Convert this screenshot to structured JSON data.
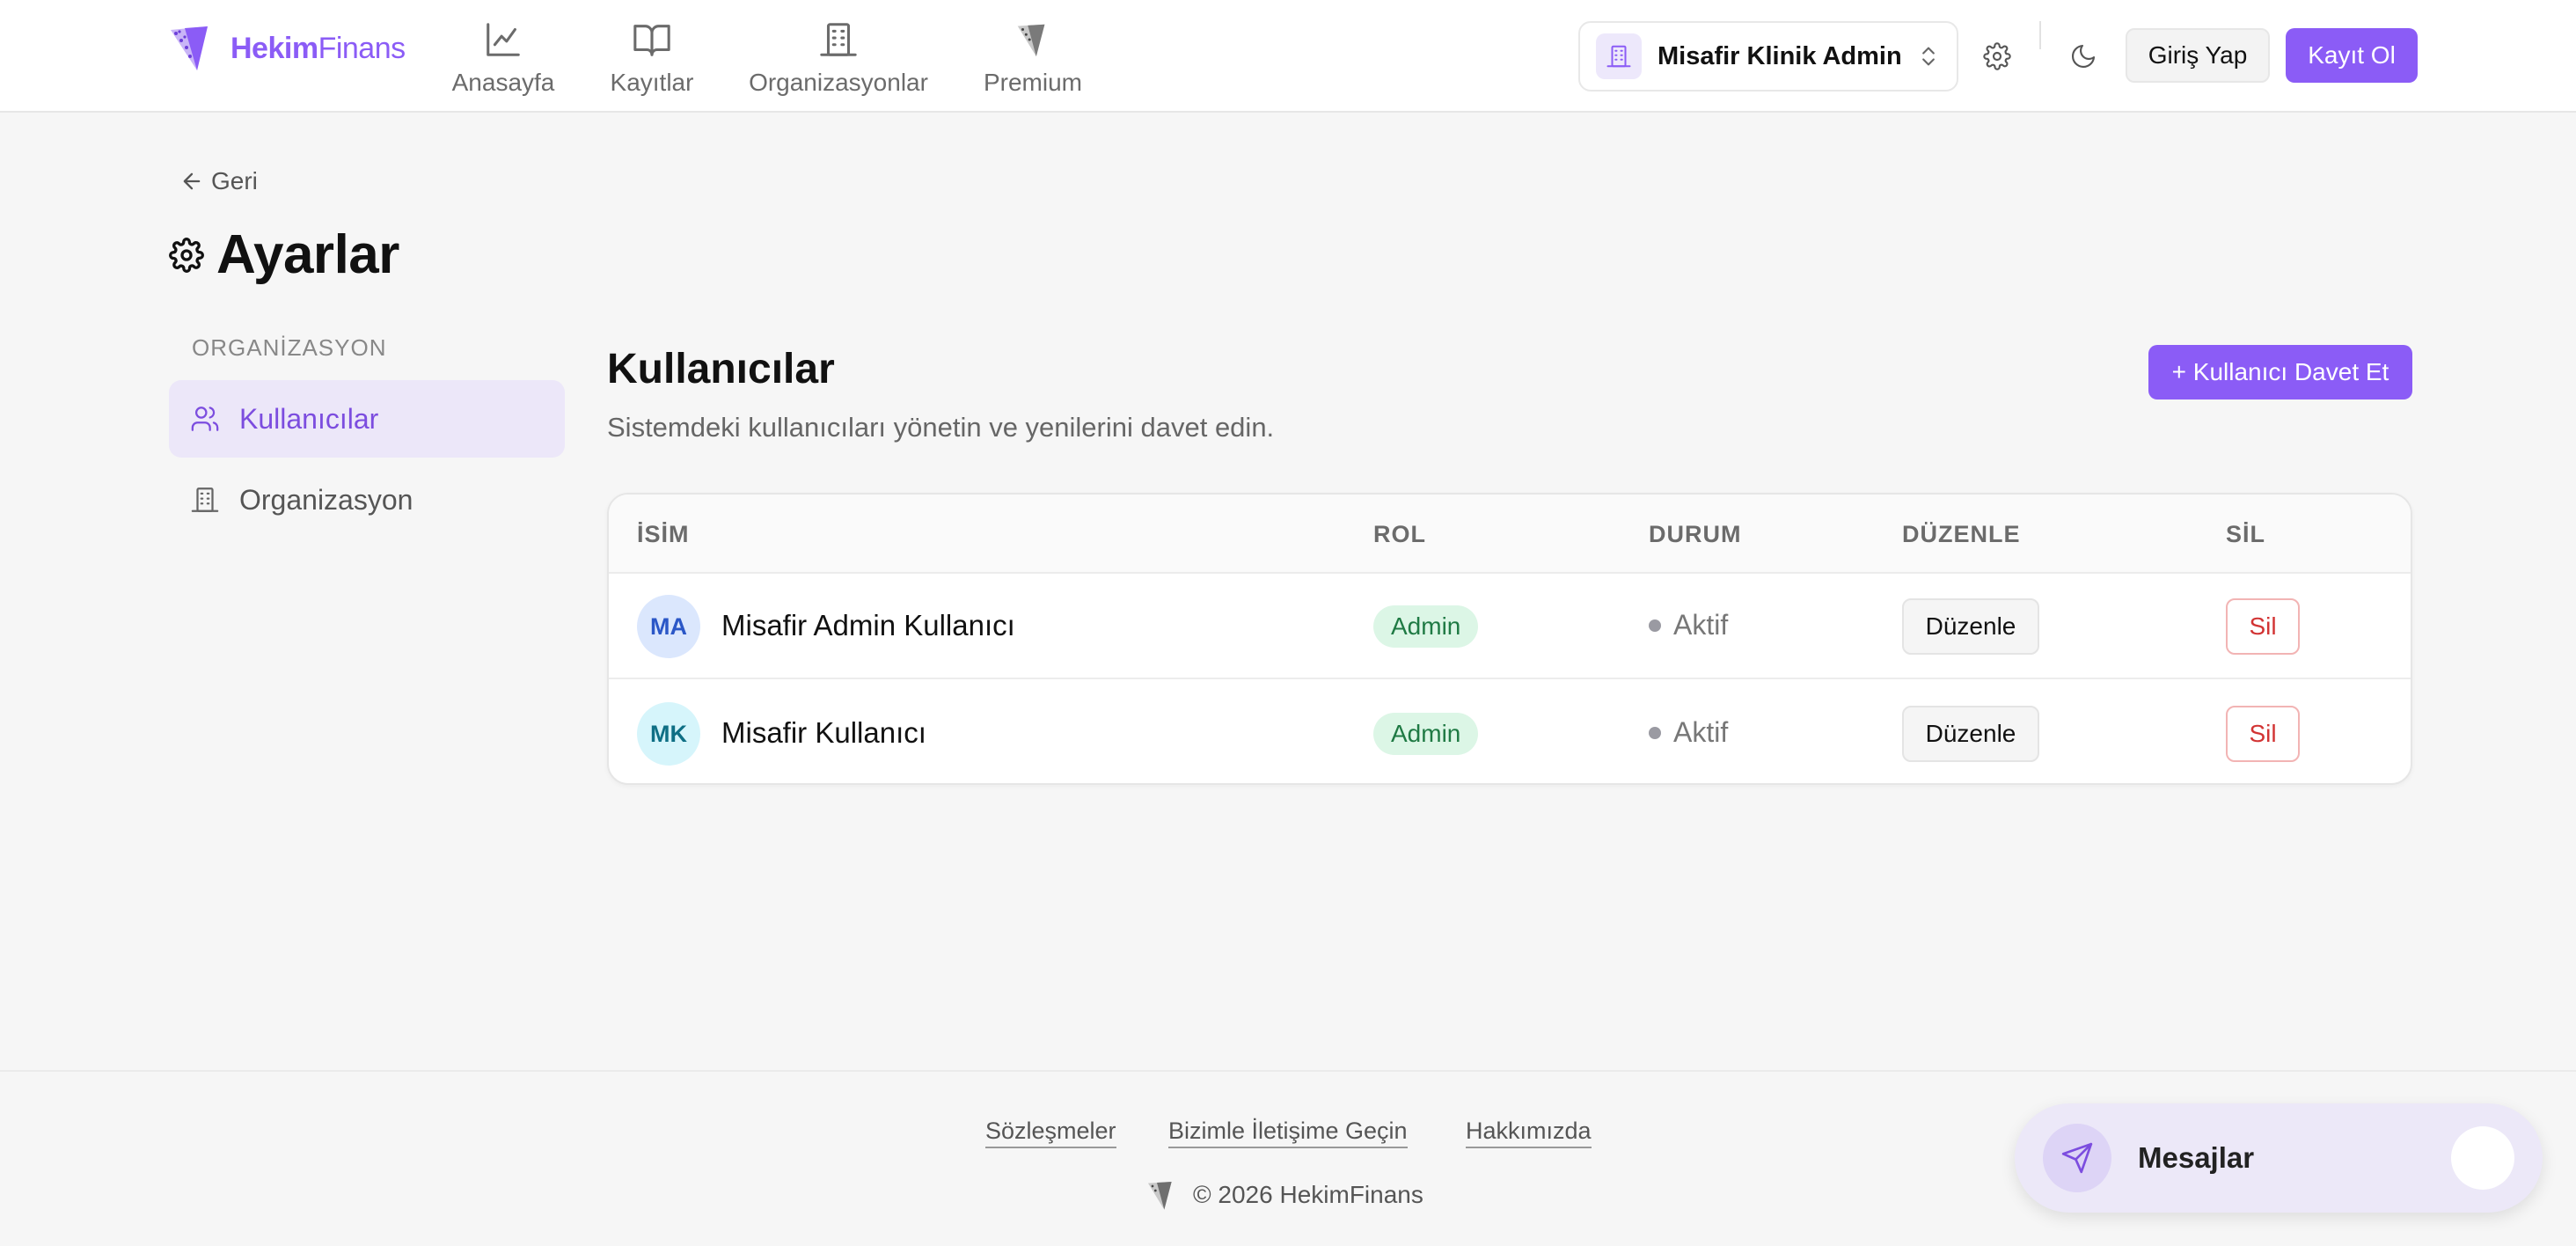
{
  "brand": {
    "name_bold": "Hekim",
    "name_light": "Finans"
  },
  "nav": [
    {
      "label": "Anasayfa",
      "icon": "chart-line-icon"
    },
    {
      "label": "Kayıtlar",
      "icon": "book-open-icon"
    },
    {
      "label": "Organizasyonlar",
      "icon": "building-icon"
    },
    {
      "label": "Premium",
      "icon": "diamond-logo-icon"
    }
  ],
  "header": {
    "org_name": "Misafir Klinik Admin",
    "login_label": "Giriş Yap",
    "register_label": "Kayıt Ol"
  },
  "page": {
    "back_label": "Geri",
    "title": "Ayarlar"
  },
  "sidebar": {
    "section_label": "ORGANİZASYON",
    "items": [
      {
        "label": "Kullanıcılar",
        "icon": "users-icon",
        "active": true
      },
      {
        "label": "Organizasyon",
        "icon": "building-icon",
        "active": false
      }
    ]
  },
  "users": {
    "title": "Kullanıcılar",
    "description": "Sistemdeki kullanıcıları yönetin ve yenilerini davet edin.",
    "invite_label": "+ Kullanıcı Davet Et",
    "columns": [
      "İSİM",
      "ROL",
      "DURUM",
      "DÜZENLE",
      "SİL"
    ],
    "rows": [
      {
        "initials": "MA",
        "name": "Misafir Admin Kullanıcı",
        "role": "Admin",
        "status": "Aktif",
        "edit_label": "Düzenle",
        "delete_label": "Sil"
      },
      {
        "initials": "MK",
        "name": "Misafir Kullanıcı",
        "role": "Admin",
        "status": "Aktif",
        "edit_label": "Düzenle",
        "delete_label": "Sil"
      }
    ]
  },
  "footer": {
    "links": [
      "Sözleşmeler",
      "Bizimle İletişime Geçin",
      "Hakkımızda"
    ],
    "copyright": "© 2026 HekimFinans"
  },
  "messages_widget": {
    "label": "Mesajlar"
  },
  "colors": {
    "accent": "#8b5cf6",
    "danger": "#d23434",
    "success_bg": "#dcf6e6"
  }
}
